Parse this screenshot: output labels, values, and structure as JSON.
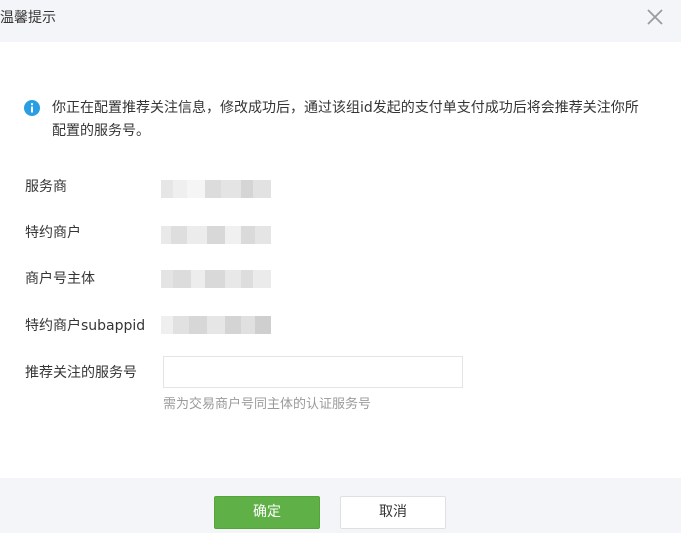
{
  "dialog": {
    "title": "温馨提示",
    "close_icon": "close-icon"
  },
  "tip": {
    "icon": "info-icon",
    "icon_color": "#2a9ee4",
    "text": "你正在配置推荐关注信息，修改成功后，通过该组id发起的支付单支付成功后将会推荐关注你所配置的服务号。"
  },
  "fields": [
    {
      "label": "服务商",
      "value_masked": true
    },
    {
      "label": "特约商户",
      "value_masked": true
    },
    {
      "label": "商户号主体",
      "value_masked": true
    },
    {
      "label": "特约商户subappid",
      "value_masked": true
    }
  ],
  "recommend": {
    "label": "推荐关注的服务号",
    "value": "",
    "hint": "需为交易商户号同主体的认证服务号"
  },
  "buttons": {
    "confirm_label": "确定",
    "cancel_label": "取消"
  },
  "colors": {
    "primary": "#5fb046",
    "header_bg": "#f4f5f9",
    "hint": "#9a9a9a"
  }
}
